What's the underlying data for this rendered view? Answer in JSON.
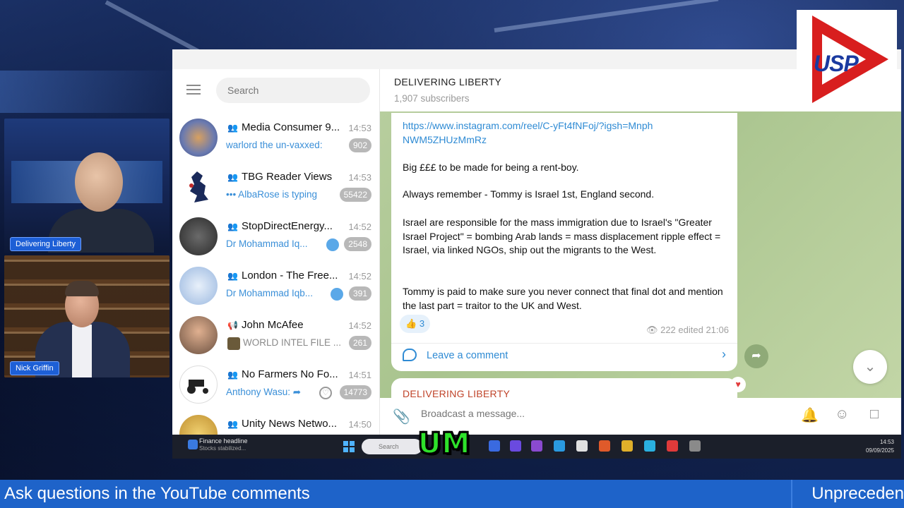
{
  "presenters": [
    {
      "name": "Delivering Liberty"
    },
    {
      "name": "Nick Griffin"
    }
  ],
  "logo": {
    "text": "USP",
    "color": "#d81e1e",
    "text_color": "#1a3aa0"
  },
  "telegram": {
    "search_placeholder": "Search",
    "chats": [
      {
        "title": "Media Consumer 9...",
        "time": "14:53",
        "preview": "warlord the un-vaxxed:",
        "badge": "902",
        "type": "group"
      },
      {
        "title": "TBG Reader Views",
        "time": "14:53",
        "preview": "••• AlbaRose is typing",
        "badge": "55422",
        "type": "group"
      },
      {
        "title": "StopDirectEnergy...",
        "time": "14:52",
        "preview": "Dr Mohammad Iq...",
        "badge": "2548",
        "type": "group"
      },
      {
        "title": "London - The Free...",
        "time": "14:52",
        "preview": "Dr Mohammad Iqb...",
        "badge": "391",
        "type": "group"
      },
      {
        "title": "John McAfee",
        "time": "14:52",
        "preview": "WORLD INTEL FILE ...",
        "badge": "261",
        "type": "channel"
      },
      {
        "title": "No Farmers No Fo...",
        "time": "14:51",
        "preview": "Anthony Wasu: ➦",
        "badge": "14773",
        "type": "group"
      },
      {
        "title": "Unity News Netwo...",
        "time": "14:50",
        "preview": "",
        "badge": "",
        "type": "group"
      }
    ],
    "channel": {
      "name": "DELIVERING LIBERTY",
      "subscribers": "1,907 subscribers"
    },
    "message": {
      "link": "https://www.instagram.com/reel/C-yFt4fNFoj/?igsh=MnphNWM5ZHUzMmRz",
      "paragraphs": [
        "Big £££ to be made for being a rent-boy.",
        "Always remember - Tommy is Israel 1st, England second.",
        "Israel are responsible for the mass immigration due to Israel's \"Greater Israel Project\" = bombing Arab lands = mass displacement ripple effect = Israel, via linked NGOs, ship out the migrants to the West.",
        "Tommy is paid to make sure you never connect that final dot and mention the last part = traitor to the UK and West."
      ],
      "reaction": {
        "emoji": "👍",
        "count": "3"
      },
      "views": "222",
      "edited": "edited 21:06",
      "comment_label": "Leave a comment"
    },
    "next_message_author": "DELIVERING LIBERTY",
    "composer_placeholder": "Broadcast a message..."
  },
  "taskbar": {
    "weather_title": "Finance headline",
    "weather_sub": "Stocks stabilized...",
    "search": "Search",
    "clock_time": "14:53",
    "clock_date": "09/09/2025"
  },
  "caption": "UM",
  "ticker": {
    "left": "Ask questions in the YouTube comments",
    "right": "Unpreceden"
  }
}
